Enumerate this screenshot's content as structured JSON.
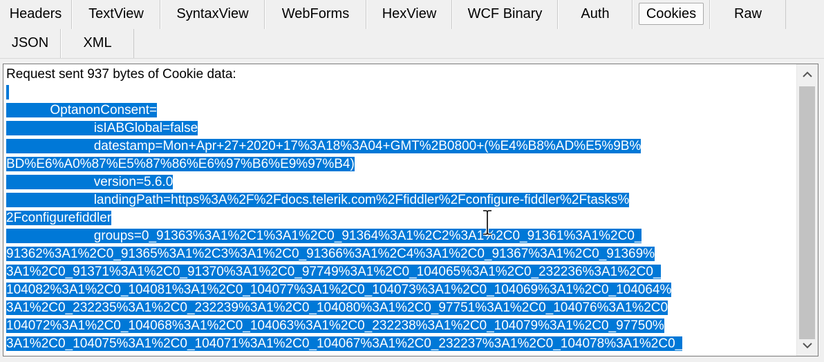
{
  "tabs_row1": [
    "Headers",
    "TextView",
    "SyntaxView",
    "WebForms",
    "HexView",
    "WCF Binary",
    "Auth",
    "Cookies",
    "Raw"
  ],
  "tabs_row2": [
    "JSON",
    "XML"
  ],
  "active_tab": "Cookies",
  "content": {
    "header": "Request sent 937 bytes of Cookie data:",
    "lines": [
      "",
      "            OptanonConsent=",
      "                        isIABGlobal=false",
      "                        datestamp=Mon+Apr+27+2020+17%3A18%3A04+GMT%2B0800+(%E4%B8%AD%E5%9B%",
      "BD%E6%A0%87%E5%87%86%E6%97%B6%E9%97%B4)",
      "                        version=5.6.0",
      "                        landingPath=https%3A%2F%2Fdocs.telerik.com%2Ffiddler%2Fconfigure-fiddler%2Ftasks%",
      "2Fconfigurefiddler",
      "                        groups=0_91363%3A1%2C1%3A1%2C0_91364%3A1%2C2%3A1%2C0_91361%3A1%2C0_",
      "91362%3A1%2C0_91365%3A1%2C3%3A1%2C0_91366%3A1%2C4%3A1%2C0_91367%3A1%2C0_91369%",
      "3A1%2C0_91371%3A1%2C0_91370%3A1%2C0_97749%3A1%2C0_104065%3A1%2C0_232236%3A1%2C0_",
      "104082%3A1%2C0_104081%3A1%2C0_104077%3A1%2C0_104073%3A1%2C0_104069%3A1%2C0_104064%",
      "3A1%2C0_232235%3A1%2C0_232239%3A1%2C0_104080%3A1%2C0_97751%3A1%2C0_104076%3A1%2C0",
      "104072%3A1%2C0_104068%3A1%2C0_104063%3A1%2C0_232238%3A1%2C0_104079%3A1%2C0_97750%",
      "3A1%2C0_104075%3A1%2C0_104071%3A1%2C0_104067%3A1%2C0_232237%3A1%2C0_104078%3A1%2C0_"
    ]
  },
  "colors": {
    "selection": "#0078d7",
    "background": "#f0f0f0"
  },
  "icons": {
    "scroll_up": "chevron-up-icon",
    "scroll_down": "chevron-down-icon",
    "text_cursor": "i-beam-cursor-icon"
  }
}
